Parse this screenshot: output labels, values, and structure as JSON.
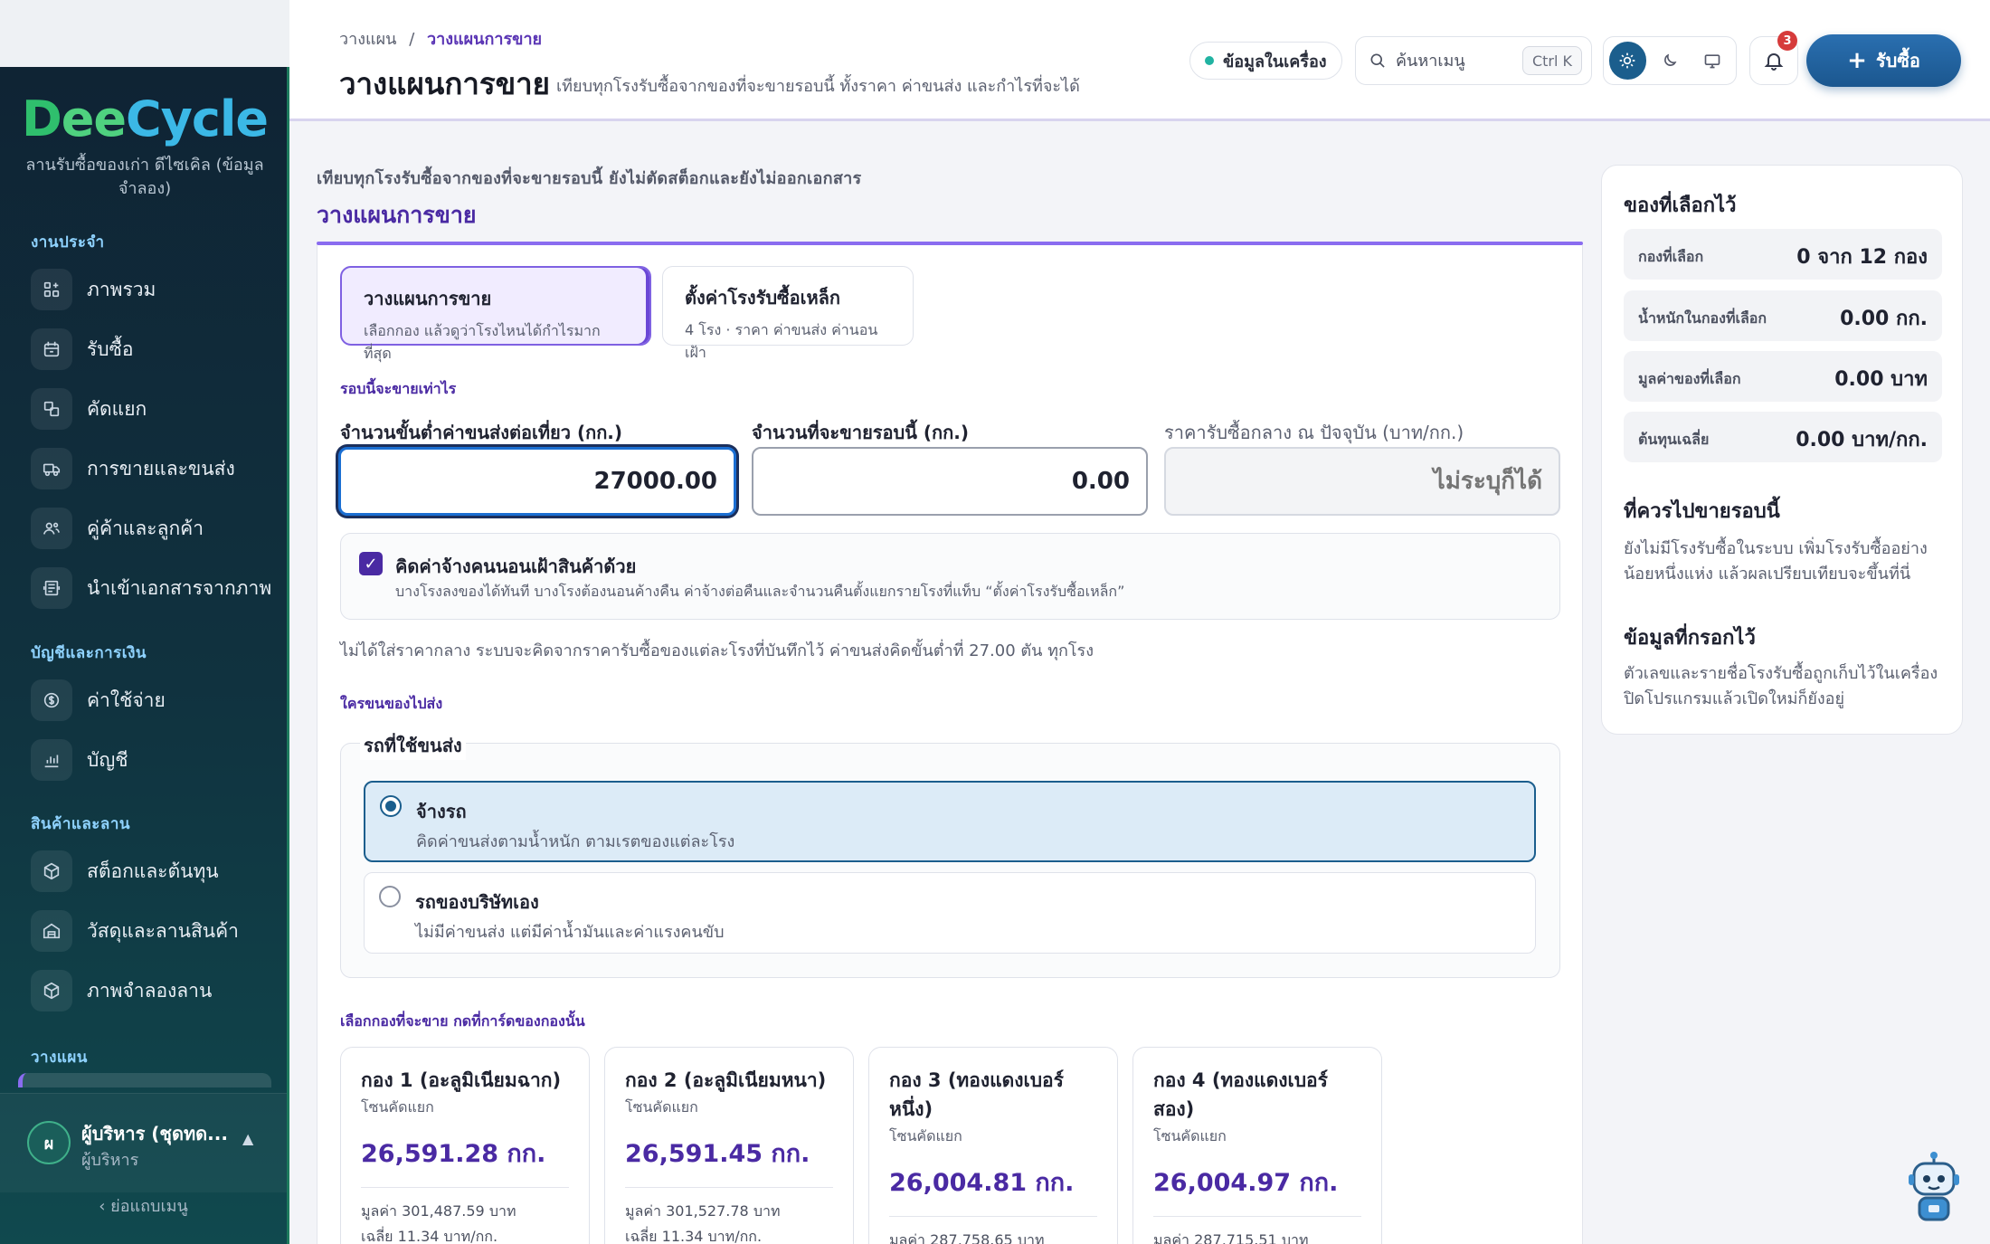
{
  "sidebar": {
    "brand_parts": {
      "d": "D",
      "ee": "ee",
      "cycle": "Cycle"
    },
    "subtitle": "ลานรับซื้อของเก่า ดีไซเคิล (ข้อมูลจำลอง)",
    "groups": {
      "work": "งานประจำ",
      "finance": "บัญชีและการเงิน",
      "goods": "สินค้าและลาน",
      "plan": "วางแผน"
    },
    "items": {
      "overview": "ภาพรวม",
      "buy": "รับซื้อ",
      "sort": "คัดแยก",
      "sales": "การขายและขนส่ง",
      "partners": "คู่ค้าและลูกค้า",
      "import": "นำเข้าเอกสารจากภาพ",
      "expenses": "ค่าใช้จ่าย",
      "accounts": "บัญชี",
      "stock": "สต็อกและต้นทุน",
      "materials": "วัสดุและลานสินค้า",
      "sim": "ภาพจำลองลาน"
    },
    "user": {
      "initial": "ผ",
      "name": "ผู้บริหาร (ชุดทด...",
      "role": "ผู้บริหาร"
    },
    "collapse_label": "‹  ย่อแถบเมนู"
  },
  "header": {
    "breadcrumb_root": "วางแผน",
    "breadcrumb_sep": "/",
    "breadcrumb_current": "วางแผนการขาย",
    "title": "วางแผนการขาย",
    "description": "เทียบทุกโรงรับซื้อจากของที่จะขายรอบนี้ ทั้งราคา ค่าขนส่ง และกำไรที่จะได้",
    "local_data": "ข้อมูลในเครื่อง",
    "search_placeholder": "ค้นหาเมนู",
    "shortcut": "Ctrl K",
    "notification_count": "3",
    "buy_button": "รับซื้อ"
  },
  "main": {
    "intro": "เทียบทุกโรงรับซื้อจากของที่จะขายรอบนี้ ยังไม่ตัดสต็อกและยังไม่ออกเอกสาร",
    "section_title": "วางแผนการขาย",
    "tabs": [
      {
        "title": "วางแผนการขาย",
        "sub": "เลือกกอง แล้วดูว่าโรงไหนได้กำไรมากที่สุด"
      },
      {
        "title": "ตั้งค่าโรงรับซื้อเหล็ก",
        "sub": "4 โรง · ราคา ค่าขนส่ง ค่านอนเฝ้า"
      }
    ],
    "qty_section": "รอบนี้จะขายเท่าไร",
    "fields": {
      "min_label": "จำนวนขั้นต่ำค่าขนส่งต่อเที่ยว (กก.)",
      "min_value": "27000.00",
      "qty_label": "จำนวนที่จะขายรอบนี้ (กก.)",
      "qty_value": "0.00",
      "price_label": "ราคารับซื้อกลาง ณ ปัจจุบัน (บาท/กก.)",
      "price_placeholder": "ไม่ระบุก็ได้"
    },
    "overnight": {
      "title": "คิดค่าจ้างคนนอนเฝ้าสินค้าด้วย",
      "desc": "บางโรงลงของได้ทันที บางโรงต้องนอนค้างคืน ค่าจ้างต่อคืนและจำนวนคืนตั้งแยกรายโรงที่แท็บ “ตั้งค่าโรงรับซื้อเหล็ก”"
    },
    "note": "ไม่ได้ใส่ราคากลาง ระบบจะคิดจากราคารับซื้อของแต่ละโรงที่บันทึกไว้ ค่าขนส่งคิดขั้นต่ำที่ 27.00 ตัน ทุกโรง",
    "transport_section": "ใครขนของไปส่ง",
    "vehicle_legend": "รถที่ใช้ขนส่ง",
    "vehicle_options": [
      {
        "title": "จ้างรถ",
        "desc": "คิดค่าขนส่งตามน้ำหนัก ตามเรตของแต่ละโรง",
        "selected": true
      },
      {
        "title": "รถของบริษัทเอง",
        "desc": "ไม่มีค่าขนส่ง แต่มีค่าน้ำมันและค่าแรงคนขับ",
        "selected": false
      }
    ],
    "lots_section": "เลือกกองที่จะขาย กดที่การ์ดของกองนั้น",
    "lots": [
      {
        "title": "กอง 1 (อะลูมิเนียมฉาก)",
        "zone": "โซนคัดแยก",
        "weight": "26,591.28 กก.",
        "value": "มูลค่า 301,487.59 บาท",
        "avg": "เฉลี่ย 11.34 บาท/กก."
      },
      {
        "title": "กอง 2 (อะลูมิเนียมหนา)",
        "zone": "โซนคัดแยก",
        "weight": "26,591.45 กก.",
        "value": "มูลค่า 301,527.78 บาท",
        "avg": "เฉลี่ย 11.34 บาท/กก."
      },
      {
        "title": "กอง 3 (ทองแดงเบอร์หนึ่ง)",
        "zone": "โซนคัดแยก",
        "weight": "26,004.81 กก.",
        "value": "มูลค่า 287,758.65 บาท",
        "avg": ""
      },
      {
        "title": "กอง 4 (ทองแดงเบอร์สอง)",
        "zone": "โซนคัดแยก",
        "weight": "26,004.97 กก.",
        "value": "มูลค่า 287,715.51 บาท",
        "avg": ""
      }
    ]
  },
  "side": {
    "selected_title": "ของที่เลือกไว้",
    "stats": [
      {
        "label": "กองที่เลือก",
        "value": "0 จาก 12 กอง"
      },
      {
        "label": "น้ำหนักในกองที่เลือก",
        "value": "0.00 กก."
      },
      {
        "label": "มูลค่าของที่เลือก",
        "value": "0.00 บาท"
      },
      {
        "label": "ต้นทุนเฉลี่ย",
        "value": "0.00 บาท/กก."
      }
    ],
    "where_title": "ที่ควรไปขายรอบนี้",
    "where_desc": "ยังไม่มีโรงรับซื้อในระบบ เพิ่มโรงรับซื้ออย่างน้อยหนึ่งแห่ง แล้วผลเปรียบเทียบจะขึ้นที่นี่",
    "saved_title": "ข้อมูลที่กรอกไว้",
    "saved_desc": "ตัวเลขและรายชื่อโรงรับซื้อถูกเก็บไว้ในเครื่อง ปิดโปรแกรมแล้วเปิดใหม่ก็ยังอยู่"
  },
  "colors": {
    "primary": "#4a2aa3",
    "accent": "#1b5e8d",
    "badge": "#d63b3b"
  },
  "icons": [
    "grid-plus-icon",
    "calendar-icon",
    "sort-icon",
    "truck-icon",
    "users-icon",
    "document-scan-icon",
    "coin-icon",
    "chart-icon",
    "box-icon",
    "warehouse-icon",
    "search-icon",
    "sun-icon",
    "moon-icon",
    "monitor-icon",
    "bell-icon",
    "plus-icon",
    "chevron-up-icon",
    "robot-icon"
  ]
}
